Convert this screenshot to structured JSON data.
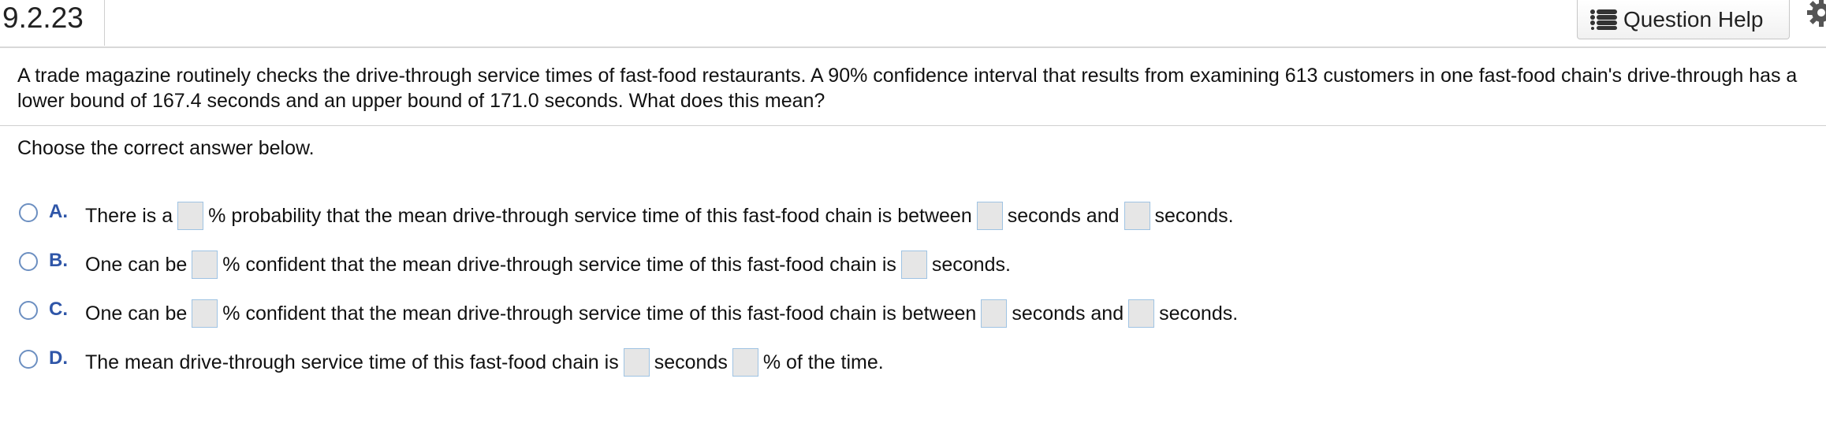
{
  "header": {
    "question_number": "9.2.23",
    "help_label": "Question Help"
  },
  "question": {
    "text": "A trade magazine routinely checks the drive-through service times of fast-food restaurants. A 90% confidence interval that results from examining 613 customers in one fast-food chain's drive-through has a lower bound of 167.4 seconds and an upper bound of 171.0 seconds. What does this mean?",
    "prompt": "Choose the correct answer below."
  },
  "options": {
    "a": {
      "letter": "A.",
      "t1": "There is a",
      "t2": "% probability that the mean drive-through service time of this fast-food chain is between",
      "t3": "seconds and",
      "t4": "seconds."
    },
    "b": {
      "letter": "B.",
      "t1": "One can be",
      "t2": "% confident that the mean drive-through service time of this fast-food chain is",
      "t3": "seconds."
    },
    "c": {
      "letter": "C.",
      "t1": "One can be",
      "t2": "% confident that the mean drive-through service time of this fast-food chain is between",
      "t3": "seconds and",
      "t4": "seconds."
    },
    "d": {
      "letter": "D.",
      "t1": "The mean drive-through service time of this fast-food chain is",
      "t2": "seconds",
      "t3": "% of the time."
    }
  },
  "colors": {
    "accent": "#2f56a8",
    "radio_border": "#6c8fc1",
    "input_fill": "#e6e6e6"
  }
}
